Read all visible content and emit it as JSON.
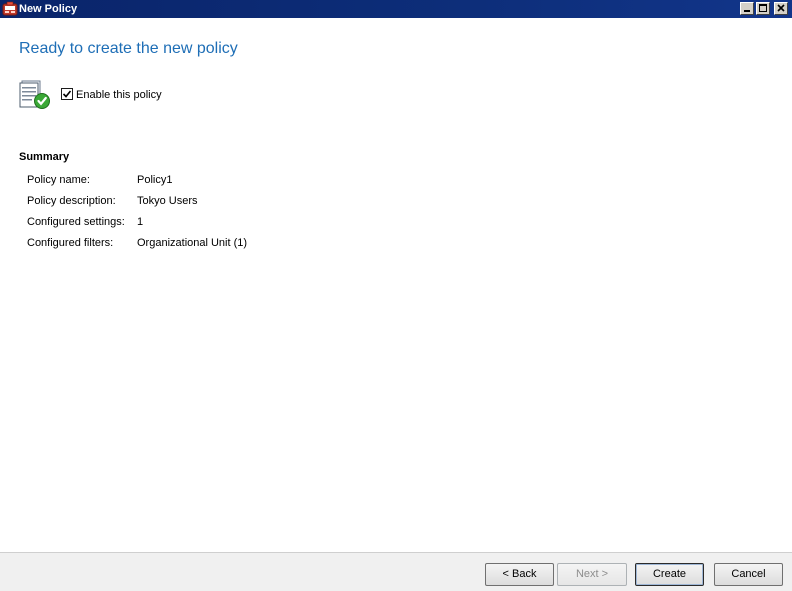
{
  "window": {
    "title": "New Policy",
    "controls": {
      "minimize": "minimize",
      "maximize": "maximize",
      "close": "close"
    }
  },
  "page": {
    "heading": "Ready to create the new policy",
    "enable_checkbox": {
      "label": "Enable this policy",
      "checked": true
    }
  },
  "summary": {
    "title": "Summary",
    "rows": [
      {
        "label": "Policy name:",
        "value": "Policy1"
      },
      {
        "label": "Policy description:",
        "value": "Tokyo Users"
      },
      {
        "label": "Configured settings:",
        "value": "1"
      },
      {
        "label": "Configured filters:",
        "value": "Organizational Unit (1)"
      }
    ]
  },
  "buttons": {
    "back": "< Back",
    "next": "Next >",
    "create": "Create",
    "cancel": "Cancel"
  },
  "icons": {
    "app": "policy-app-icon",
    "policy": "policy-document-check-icon"
  },
  "colors": {
    "titlebar": "#0a246a",
    "heading": "#1e6eb6",
    "check": "#3aa836"
  }
}
